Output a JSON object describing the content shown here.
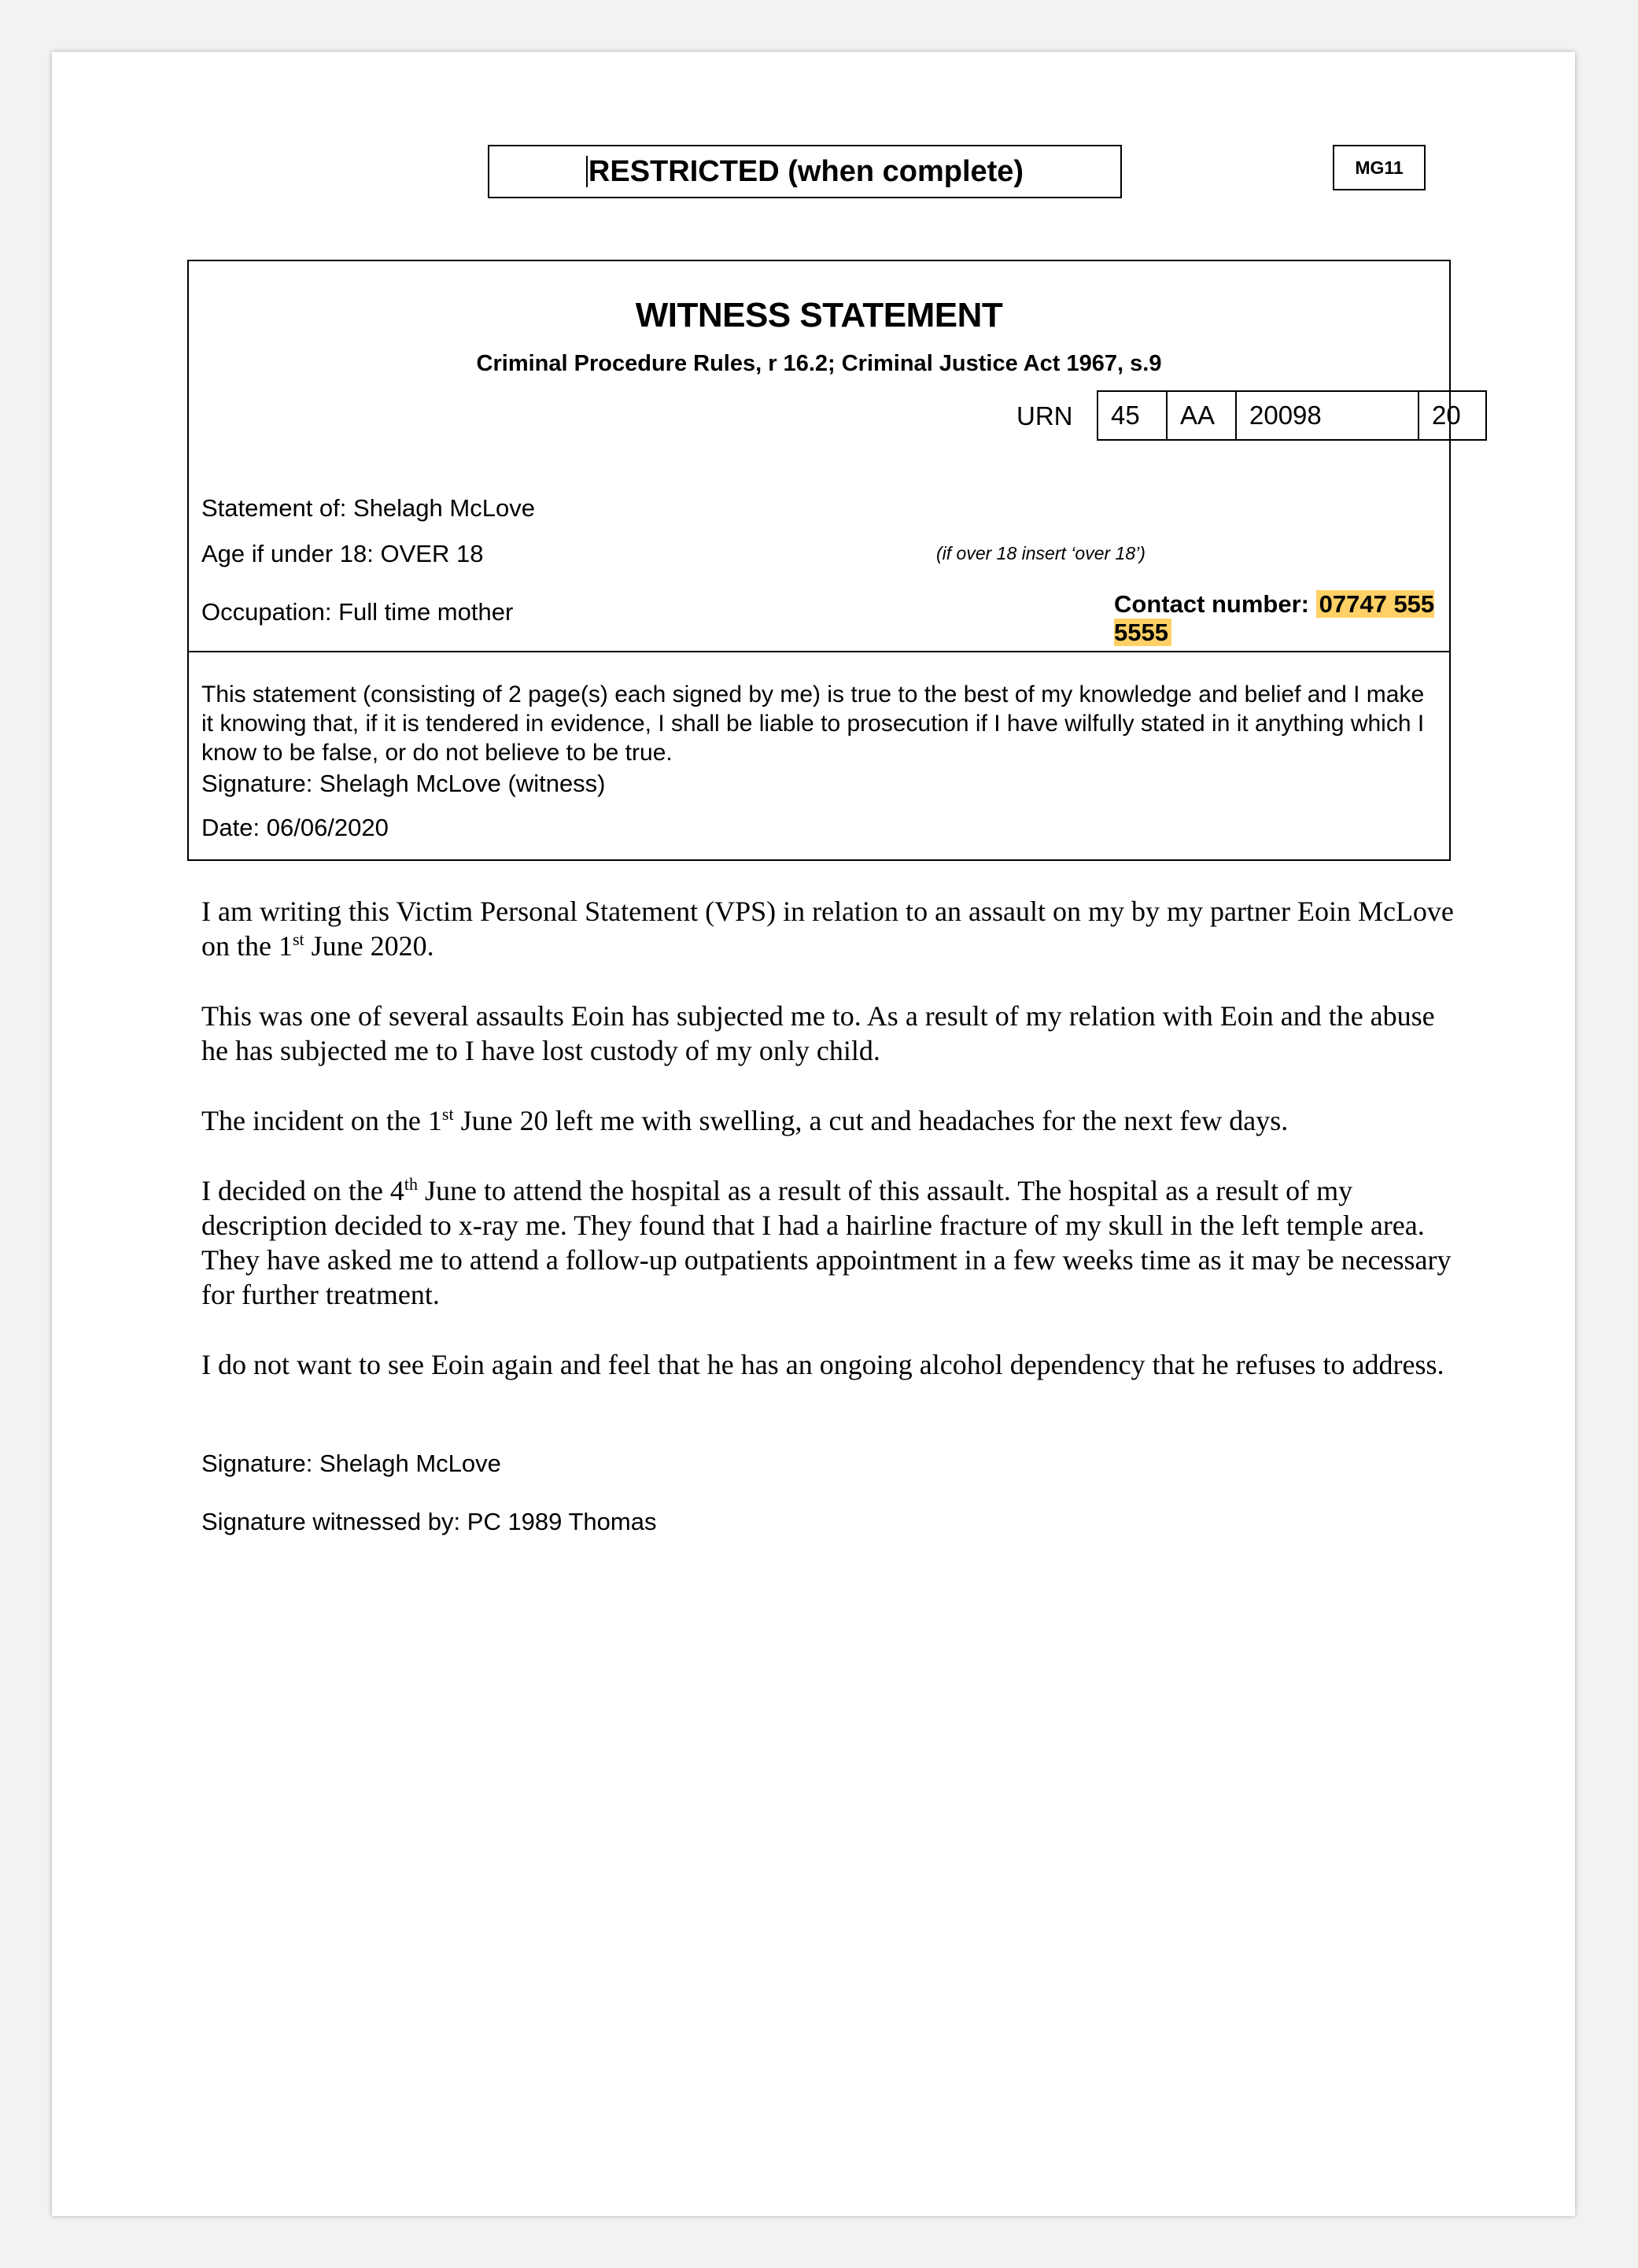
{
  "header": {
    "restricted_label": "RESTRICTED (when complete)",
    "form_code": "MG11"
  },
  "form": {
    "title": "WITNESS STATEMENT",
    "subtitle": "Criminal Procedure Rules, r 16.2; Criminal Justice Act 1967, s.9",
    "urn_label": "URN",
    "urn_parts": [
      "45",
      "AA",
      "20098",
      "20"
    ],
    "statement_of_label": "Statement of:",
    "statement_of_value": "Shelagh McLove",
    "age_label": "Age if under 18:",
    "age_value": "OVER 18",
    "age_hint": "(if over 18 insert ‘over 18’)",
    "occupation_label": "Occupation:",
    "occupation_value": "Full time mother",
    "contact_label": "Contact number:",
    "contact_value": "07747 555 5555",
    "highlight_color": "#ffd066",
    "declaration": "This statement (consisting of 2 page(s) each signed by me) is true to the best of my knowledge and belief and I make it knowing that, if it is tendered in evidence, I shall be liable to prosecution if I have wilfully stated in it anything which I know to be false, or do not believe to be true.",
    "signature_label": "Signature:",
    "signature_value": "Shelagh McLove (witness)",
    "date_label": "Date:",
    "date_value": "06/06/2020"
  },
  "statement": {
    "p1_a": "I am writing this Victim Personal Statement (VPS) in relation to an assault on my by my partner Eoin McLove on the 1",
    "p1_sup": "st",
    "p1_b": " June 2020.",
    "p2": "This was one of several assaults Eoin has subjected me to. As a result of my relation with Eoin and the abuse he has subjected me to I have lost custody of my only child.",
    "p3_a": "The incident on the 1",
    "p3_sup": "st",
    "p3_b": " June 20 left me with swelling, a cut and headaches for the next few days.",
    "p4_a": "I decided on the 4",
    "p4_sup": "th",
    "p4_b": " June to attend the hospital as a result of this assault. The hospital as a result of my description decided to x-ray me. They found that I had a hairline fracture of my skull in the left temple area. They have asked me to attend a follow-up outpatients appointment in a few weeks time as it may be necessary for further treatment.",
    "p5": "I do not want to see Eoin again and feel that he has an ongoing alcohol dependency that he refuses to address."
  },
  "footer": {
    "signature_label": "Signature:",
    "signature_value": "Shelagh McLove",
    "witnessed_label": "Signature witnessed by:",
    "witnessed_value": "PC 1989 Thomas"
  }
}
